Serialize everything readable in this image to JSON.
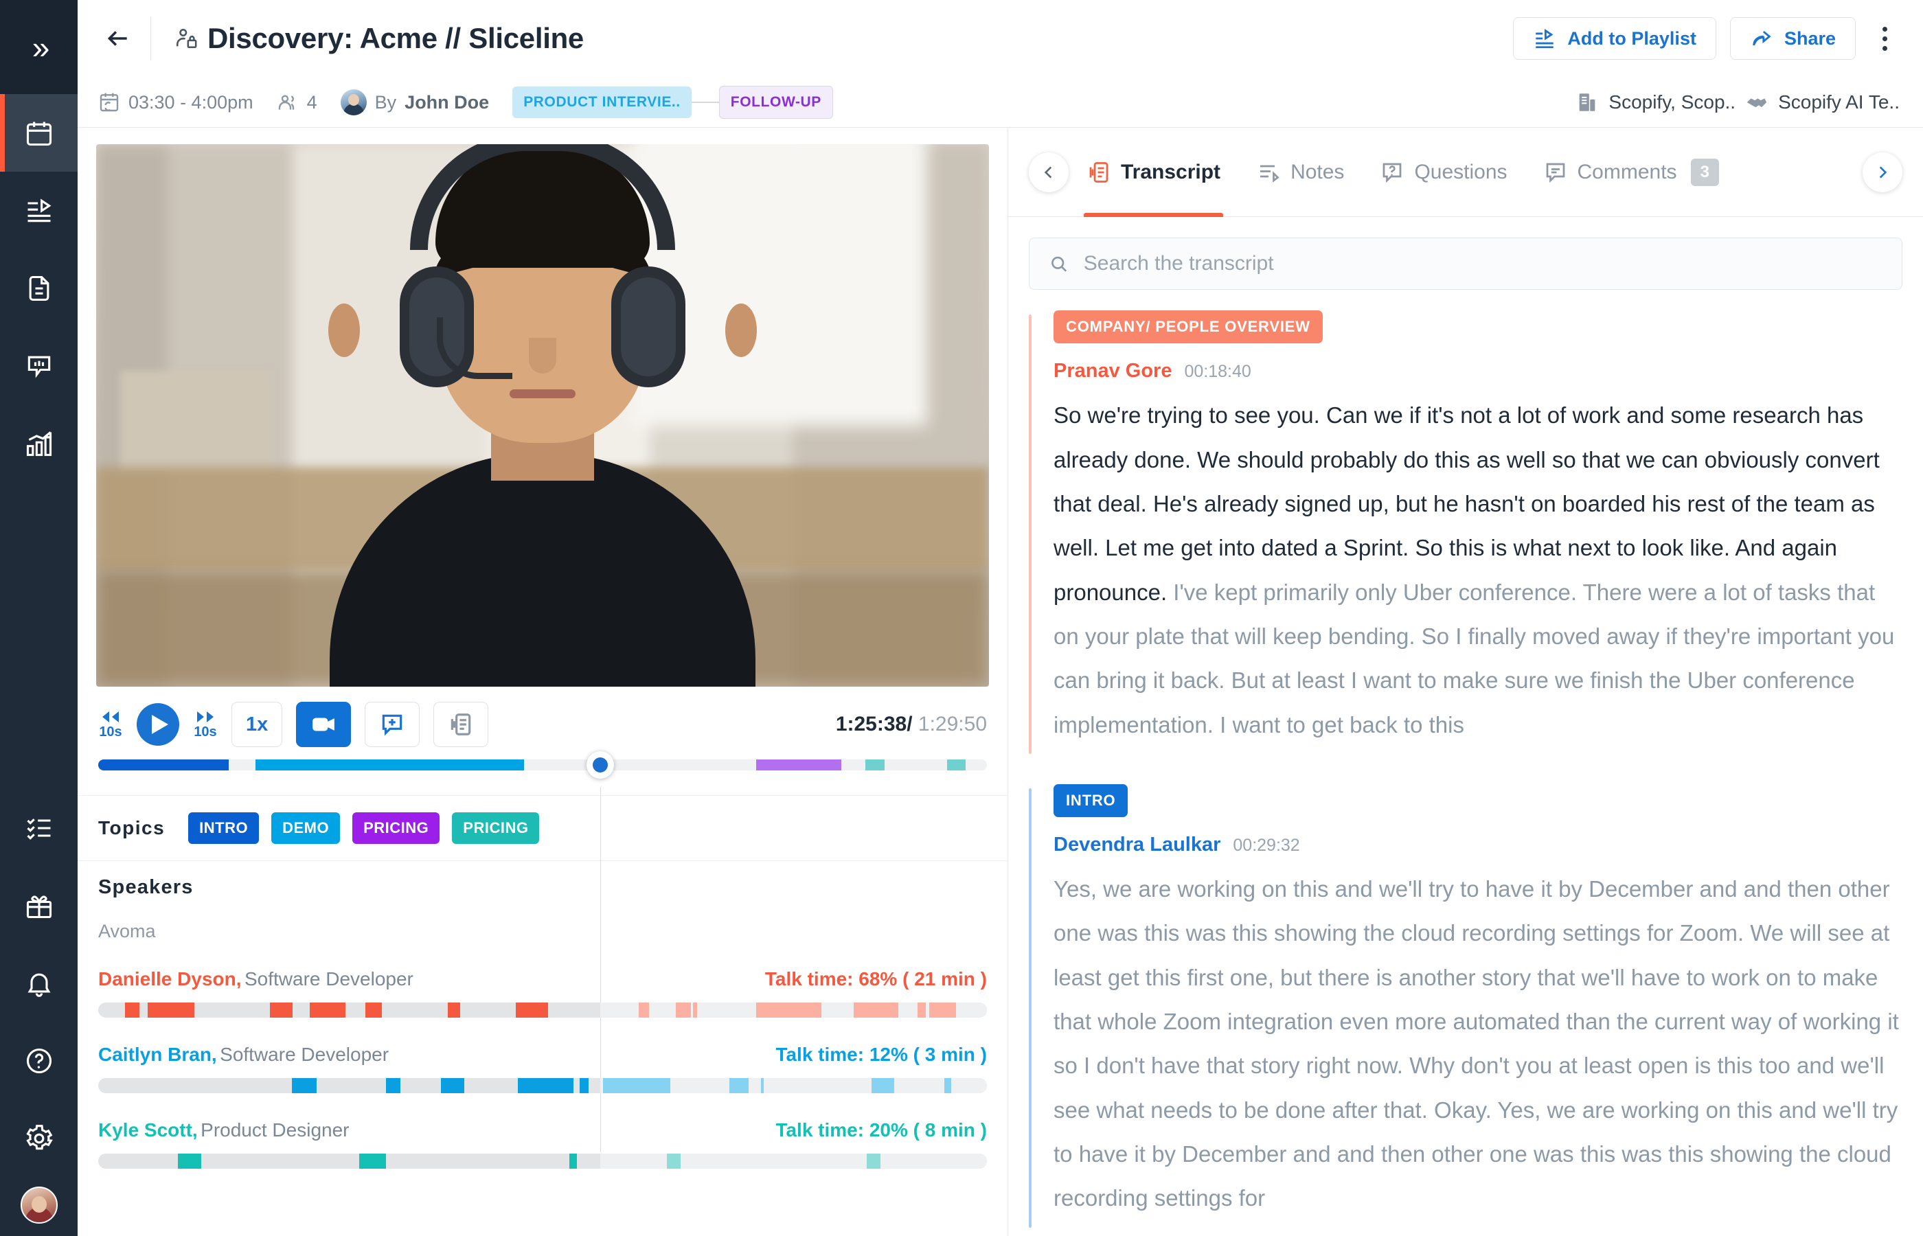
{
  "rail": {
    "expand_icon": "chevron-double-right-icon",
    "items": [
      {
        "icon": "calendar-icon",
        "name": "meetings",
        "active": true
      },
      {
        "icon": "playlist-icon",
        "name": "playlists",
        "active": false
      },
      {
        "icon": "document-icon",
        "name": "notes",
        "active": false
      },
      {
        "icon": "conversation-icon",
        "name": "conversations",
        "active": false
      },
      {
        "icon": "revenue-chart-icon",
        "name": "deal-intelligence",
        "active": false
      }
    ],
    "bottom_items": [
      {
        "icon": "checklist-icon",
        "name": "tasks"
      },
      {
        "icon": "gift-icon",
        "name": "whats-new"
      },
      {
        "icon": "bell-icon",
        "name": "notifications"
      },
      {
        "icon": "help-icon",
        "name": "help"
      },
      {
        "icon": "gear-icon",
        "name": "settings"
      }
    ]
  },
  "header": {
    "back_icon": "arrow-left-icon",
    "privacy_icon": "person-lock-icon",
    "title": "Discovery: Acme // Sliceline",
    "time_range": "03:30 - 4:00pm",
    "attendee_count": "4",
    "organizer_prefix": "By",
    "organizer": "John Doe",
    "chips": [
      {
        "label": "PRODUCT INTERVIE..",
        "style": "blue"
      },
      {
        "label": "FOLLOW-UP",
        "style": "purple"
      }
    ],
    "account": "Scopify, Scop..",
    "deal": "Scopify AI Te..",
    "actions": {
      "add_to_playlist": "Add to Playlist",
      "share": "Share",
      "more": "more-options"
    }
  },
  "player": {
    "rewind_label": "10s",
    "forward_label": "10s",
    "speed": "1x",
    "current_time": "1:25:38/",
    "total_time": "1:29:50",
    "progress_percent": 56.5,
    "segments": [
      {
        "start": 0.0,
        "width": 14.7,
        "color": "#0a5fd0"
      },
      {
        "start": 17.7,
        "width": 30.2,
        "color": "#00a4e4"
      },
      {
        "start": 74.0,
        "width": 9.6,
        "color": "#b070f0"
      },
      {
        "start": 86.3,
        "width": 2.2,
        "color": "#6ed0cf"
      },
      {
        "start": 95.5,
        "width": 2.1,
        "color": "#6ed0cf"
      }
    ]
  },
  "topics": {
    "label": "Topics",
    "tags": [
      {
        "label": "INTRO",
        "color": "#0a5fd0"
      },
      {
        "label": "DEMO",
        "color": "#00a4e4"
      },
      {
        "label": "PRICING",
        "color": "#9b1fe8"
      },
      {
        "label": "PRICING",
        "color": "#1cbcb4"
      }
    ]
  },
  "speakers": {
    "title": "Speakers",
    "org": "Avoma",
    "rows": [
      {
        "name": "Danielle Dyson,",
        "role": "Software Developer",
        "talk_time": "Talk time: 68%  ( 21 min )",
        "color": "#f4593f",
        "color_dim": "#fbb0a2",
        "segments": [
          {
            "start": 3.0,
            "width": 1.6
          },
          {
            "start": 5.6,
            "width": 5.2
          },
          {
            "start": 19.3,
            "width": 2.6
          },
          {
            "start": 23.8,
            "width": 4.0
          },
          {
            "start": 30.1,
            "width": 1.8
          },
          {
            "start": 39.3,
            "width": 1.4
          },
          {
            "start": 47.0,
            "width": 3.6
          },
          {
            "start": 60.8,
            "width": 1.2
          },
          {
            "start": 65.0,
            "width": 1.7
          },
          {
            "start": 66.9,
            "width": 0.5
          },
          {
            "start": 74.0,
            "width": 7.4
          },
          {
            "start": 85.0,
            "width": 5.0
          },
          {
            "start": 92.2,
            "width": 0.9
          },
          {
            "start": 93.5,
            "width": 3.0
          }
        ]
      },
      {
        "name": "Caitlyn Bran,",
        "role": "Software Developer",
        "talk_time": "Talk time: 12%  ( 3 min )",
        "color": "#0a9fe0",
        "color_dim": "#85d2f2",
        "segments": [
          {
            "start": 21.8,
            "width": 2.8
          },
          {
            "start": 32.4,
            "width": 1.6
          },
          {
            "start": 38.6,
            "width": 2.6
          },
          {
            "start": 47.2,
            "width": 6.3
          },
          {
            "start": 54.2,
            "width": 1.0
          },
          {
            "start": 56.8,
            "width": 7.6
          },
          {
            "start": 71.0,
            "width": 2.2
          },
          {
            "start": 74.6,
            "width": 0.3
          },
          {
            "start": 87.0,
            "width": 2.6
          },
          {
            "start": 95.2,
            "width": 0.8
          }
        ]
      },
      {
        "name": "Kyle Scott,",
        "role": "Product Designer",
        "talk_time": "Talk time: 20%  ( 8 min )",
        "color": "#14bfb3",
        "color_dim": "#8ddcd8",
        "segments": [
          {
            "start": 9.0,
            "width": 2.6
          },
          {
            "start": 29.4,
            "width": 3.0
          },
          {
            "start": 53.0,
            "width": 0.9
          },
          {
            "start": 64.0,
            "width": 1.5
          },
          {
            "start": 86.5,
            "width": 1.5
          }
        ]
      }
    ]
  },
  "right_panel": {
    "prev_icon": "chevron-left-icon",
    "next_icon": "chevron-right-icon",
    "tabs": [
      {
        "label": "Transcript",
        "icon": "transcript-icon",
        "active": true,
        "badge": null
      },
      {
        "label": "Notes",
        "icon": "notes-icon",
        "active": false,
        "badge": null
      },
      {
        "label": "Questions",
        "icon": "question-icon",
        "active": false,
        "badge": null
      },
      {
        "label": "Comments",
        "icon": "comment-icon",
        "active": false,
        "badge": "3"
      }
    ],
    "search_placeholder": "Search the transcript",
    "search_value": "",
    "search_icon": "search-icon",
    "blocks": [
      {
        "tag": "COMPANY/ PEOPLE OVERVIEW",
        "tag_color": "#f9866a",
        "bar_color": "#fbc3b6",
        "speaker": "Pranav Gore",
        "speaker_color": "#f4593f",
        "timestamp": "00:18:40",
        "text_read": "So we're trying to see you. Can we if it's not a lot of work and some research has already done. We should probably do this as well so that we can obviously convert that deal. He's already signed up, but he hasn't on boarded his rest of the team as well. Let me get into dated a Sprint. So this is what next to look like. And again pronounce.",
        "text_unread": " I've kept primarily only Uber conference. There were a lot of tasks that on your plate that will keep bending. So I finally moved away if they're important you can bring it back. But at least I want to make sure we finish the Uber conference implementation. I want to get back to this"
      },
      {
        "tag": "INTRO",
        "tag_color": "#0f72d4",
        "bar_color": "#a8cdf0",
        "speaker": "Devendra Laulkar",
        "speaker_color": "#1a73d1",
        "timestamp": "00:29:32",
        "text_read": "",
        "text_unread": "Yes, we are working on this and we'll try to have it by December and and then other one was this was this showing the cloud recording settings for Zoom. We will see at least get this first one, but there is another story that we'll have to work on to make that whole Zoom integration even more automated than the current way of working it so I don't have that story right now. Why don't you at least open is this too and we'll see what needs to be done after that. Okay. Yes, we are working on this and we'll try to have it by December and and then other one was this was this showing the cloud recording settings for"
      }
    ]
  }
}
